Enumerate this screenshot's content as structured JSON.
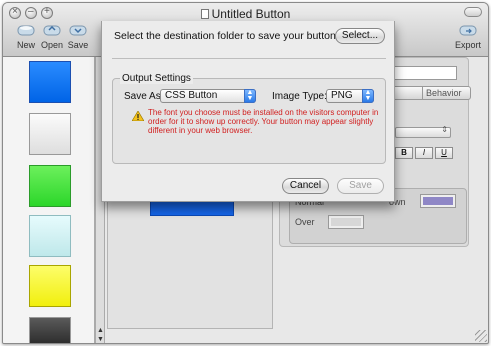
{
  "window": {
    "title": "Untitled Button"
  },
  "toolbar": {
    "new_label": "New",
    "open_label": "Open",
    "save_label": "Save",
    "export_label": "Export"
  },
  "right_panel": {
    "tab_partial_1": "ment",
    "tab_behavior": "Behavior",
    "bold_label": "B",
    "italic_label": "I",
    "underline_label": "U",
    "normal_label": "Normal",
    "down_label": "own",
    "over_label": "Over",
    "colors": {
      "down": "#8f87c6",
      "over": "#d7d7d7"
    }
  },
  "swatches": {
    "colors": [
      "#0064e6",
      "#e6e6e6",
      "#2cd62a",
      "#bfe8ea",
      "#f1ef0d",
      "#2c2c2c"
    ]
  },
  "dialog": {
    "destination_label": "Select the destination folder to save your button:",
    "select_button": "Select...",
    "output_settings_label": "Output Settings",
    "save_as_label": "Save As:",
    "save_as_value": "CSS Button",
    "image_type_label": "Image Type:",
    "image_type_value": "PNG",
    "warning_text": "The font you choose must be installed on the visitors computer in order for it to show up correctly. Your button may appear slightly different in your web browser.",
    "cancel_button": "Cancel",
    "save_button": "Save"
  }
}
